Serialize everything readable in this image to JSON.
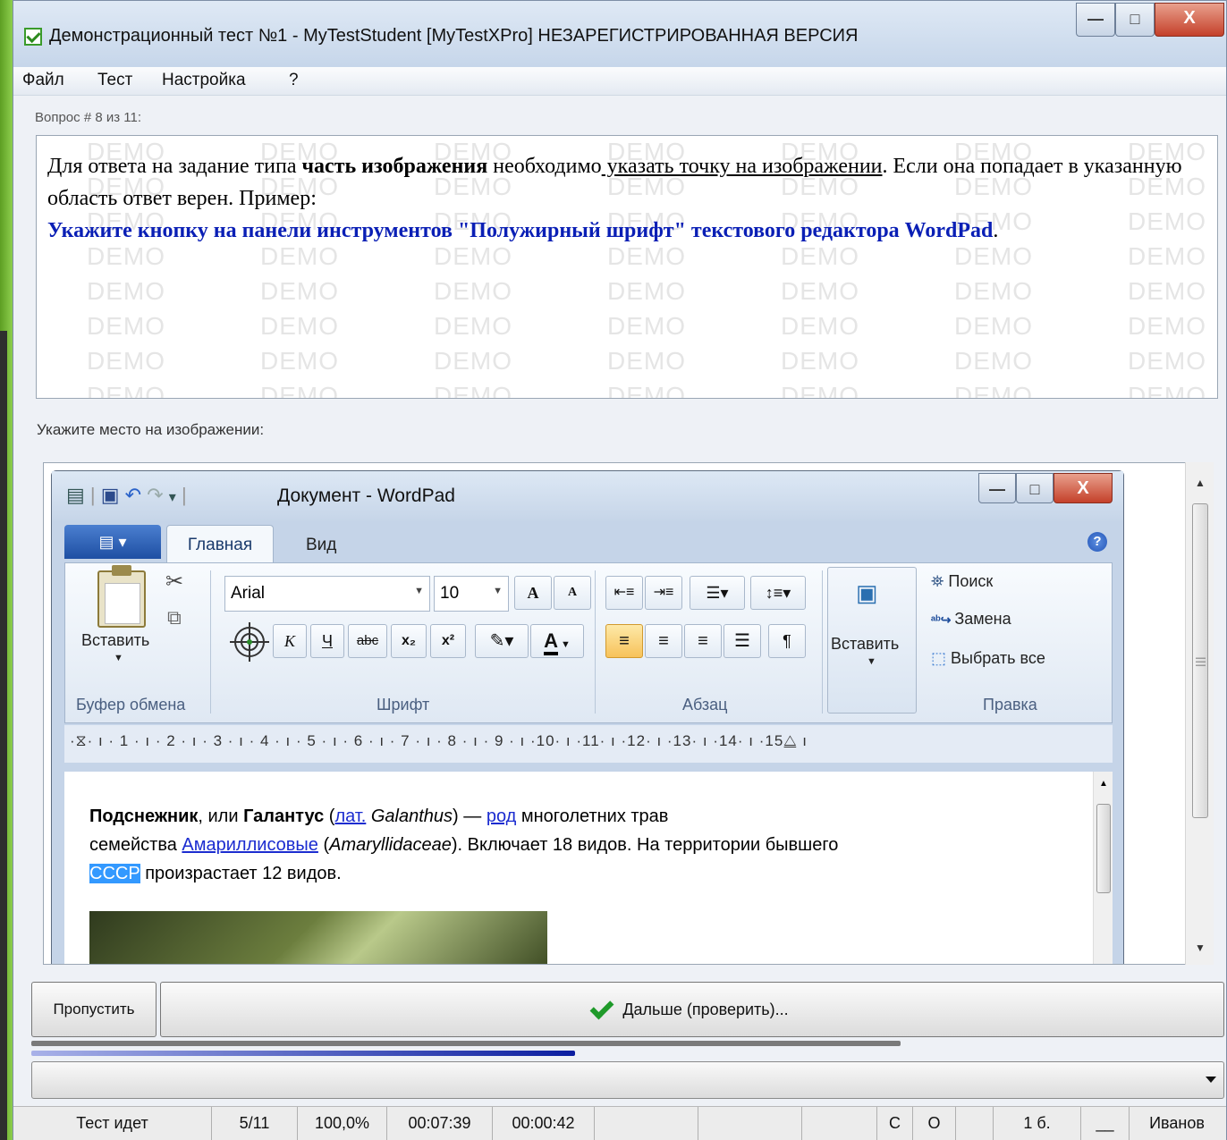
{
  "window": {
    "title": "Демонстрационный тест №1 - MyTestStudent [MyTestXPro] НЕЗАРЕГИСТРИРОВАННАЯ ВЕРСИЯ",
    "minimize": "—",
    "maximize": "□",
    "close": "X"
  },
  "menu": {
    "items": [
      "Файл",
      "Тест",
      "Настройка",
      "?"
    ]
  },
  "question": {
    "counter": "Вопрос # 8 из 11:",
    "watermark": "DEMO",
    "line1_a": "Для ответа на задание типа ",
    "line1_b": "часть изображения",
    "line1_c": " необходимо",
    "line1_d": " указать точку на изображении",
    "line1_e": ". Если она попадает в указанную область ответ верен. Пример:",
    "task_bold": "Укажите кнопку на панели инструментов \"Полужирный шрифт\" текстового редактора WordPad",
    "task_end": "."
  },
  "prompt": "Укажите место на изображении:",
  "wordpad": {
    "title": "Документ - WordPad",
    "tabs": [
      "Главная",
      "Вид"
    ],
    "groups": {
      "clipboard": "Буфер обмена",
      "font": "Шрифт",
      "paragraph": "Абзац",
      "edit": "Правка"
    },
    "paste_label": "Вставить",
    "insert_label": "Вставить",
    "font_name": "Arial",
    "font_size": "10",
    "edit": {
      "find": "Поиск",
      "replace": "Замена",
      "select_all": "Выбрать все"
    },
    "font_buttons": {
      "grow": "A",
      "shrink": "A",
      "italic": "К",
      "underline": "Ч",
      "strike": "abc",
      "sub": "x₂",
      "sup": "x²",
      "color": "A"
    },
    "ruler": "·⧖· ı · 1 · ı · 2 · ı · 3 · ı · 4 · ı · 5 · ı · 6 · ı · 7 · ı · 8 · ı · 9 · ı ·10· ı ·11· ı ·12· ı ·13· ı ·14· ı ·15⧋ ı",
    "doc": {
      "w1": "Подснежник",
      "w2": ", или ",
      "w3": "Галантус",
      "w4": " (",
      "w5": "лат.",
      "w6": " ",
      "w7": "Galanthus",
      "w8": ") — ",
      "w9": "род",
      "w10": " многолетних трав",
      "w11": "семейства ",
      "w12": "Амариллисовые",
      "w13": " (",
      "w14": "Amaryllidaceae",
      "w15": "). Включает 18 видов. На территории бывшего",
      "w16": "СССР",
      "w17": " произрастает 12 видов."
    }
  },
  "buttons": {
    "skip": "Пропустить",
    "next": "Дальше (проверить)..."
  },
  "progress": {
    "value": 0.625
  },
  "status": {
    "state": "Тест идет",
    "count": "5/11",
    "percent": "100,0%",
    "time_total": "00:07:39",
    "time_question": "00:00:42",
    "c": "С",
    "o": "О",
    "score": "1 б.",
    "blank": "__",
    "user": "Иванов"
  }
}
